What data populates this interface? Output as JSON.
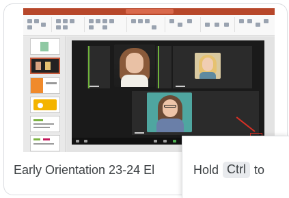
{
  "result": {
    "title": "Early Orientation 23-24 El",
    "thumbnail_icon": "powerpoint-slide-thumbnail"
  },
  "tooltip": {
    "prefix": "Hold",
    "key": "Ctrl",
    "suffix": "to"
  },
  "colors": {
    "ribbon": "#b7472a",
    "accent_red": "#d93025",
    "tooltip_key_bg": "#e8eaed",
    "text": "#3c4043"
  }
}
